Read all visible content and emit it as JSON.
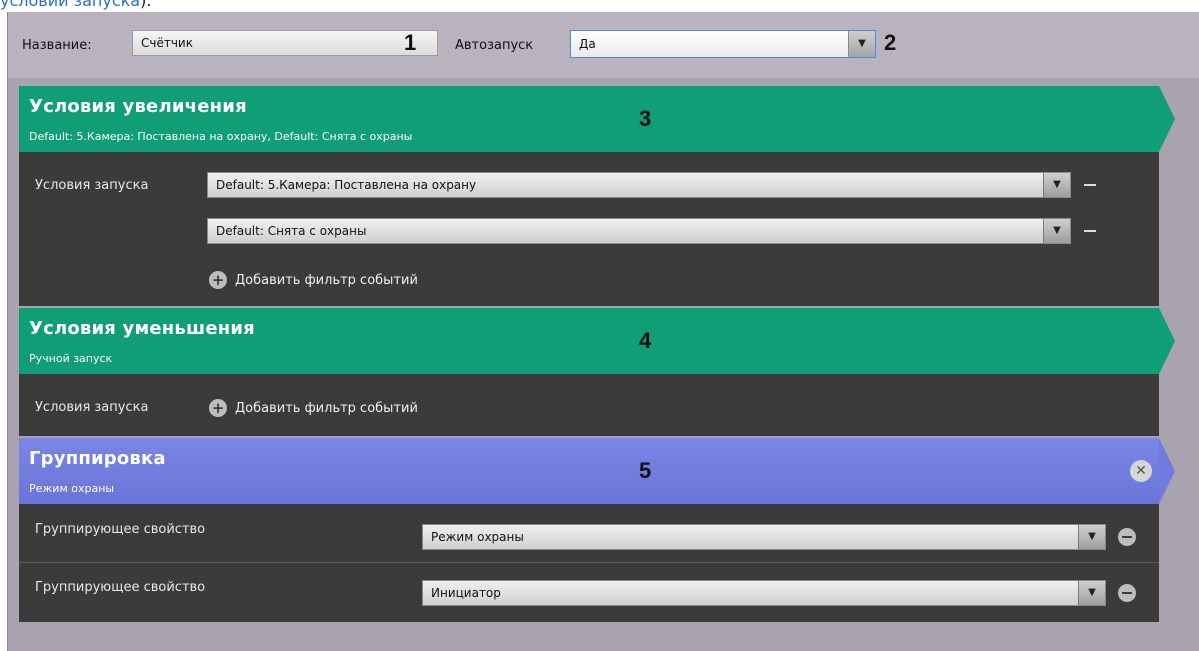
{
  "top_link": {
    "text": "условий запуска",
    "tail": ")."
  },
  "header": {
    "name_label": "Название:",
    "name_value": "Счётчик",
    "autostart_label": "Автозапуск",
    "autostart_value": "Да",
    "callout_1": "1",
    "callout_2": "2"
  },
  "increase": {
    "title": "Условия увеличения",
    "subtitle": "Default: 5.Камера: Поставлена на охрану, Default: Снята с охраны",
    "callout": "3",
    "conditions_label": "Условия запуска",
    "filters": [
      "Default: 5.Камера: Поставлена на охрану",
      "Default: Снята с охраны"
    ],
    "add_filter_label": "Добавить фильтр событий"
  },
  "decrease": {
    "title": "Условия уменьшения",
    "subtitle": "Ручной запуск",
    "callout": "4",
    "conditions_label": "Условия запуска",
    "add_filter_label": "Добавить фильтр событий"
  },
  "grouping": {
    "title": "Группировка",
    "subtitle": "Режим охраны",
    "callout": "5",
    "rows": [
      {
        "label": "Группирующее свойство",
        "value": "Режим охраны"
      },
      {
        "label": "Группирующее свойство",
        "value": "Инициатор"
      }
    ]
  },
  "colors": {
    "green_band": "#0f9e76",
    "blue_band": "#6f7bde",
    "panel": "#3b3b3b",
    "frame": "#a9a3b0"
  },
  "icons": [
    "plus-circle-icon",
    "minus-circle-icon",
    "close-circle-icon",
    "chevron-down-icon"
  ]
}
